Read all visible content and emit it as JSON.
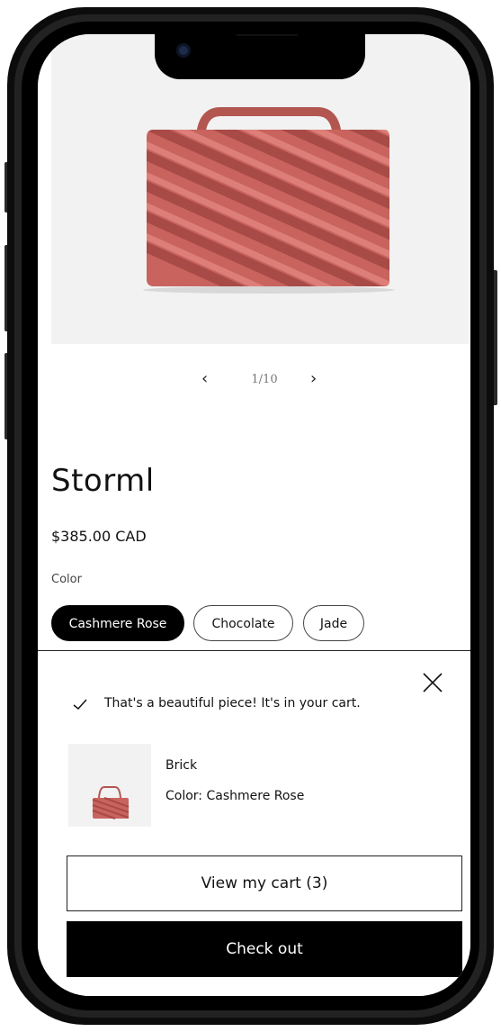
{
  "slider": {
    "prev_glyph": "‹",
    "next_glyph": "›",
    "counter": "1/10"
  },
  "product": {
    "title": "Storml",
    "price": "$385.00 CAD",
    "color_label": "Color",
    "color_options": [
      "Cashmere Rose",
      "Chocolate",
      "Jade"
    ],
    "selected_color": "Cashmere Rose"
  },
  "notification": {
    "message": "That's a beautiful piece! It's in your cart.",
    "item": {
      "name": "Brick",
      "color": "Color: Cashmere Rose"
    },
    "view_cart_label": "View my cart (3)",
    "checkout_label": "Check out"
  },
  "icons": {
    "close": "close-icon",
    "check": "check-icon",
    "prev": "chevron-left-icon",
    "next": "chevron-right-icon"
  },
  "colors": {
    "bag": "#c8635e",
    "media_bg": "#f2f2f2",
    "button_dark": "#000000",
    "text": "#121212"
  }
}
